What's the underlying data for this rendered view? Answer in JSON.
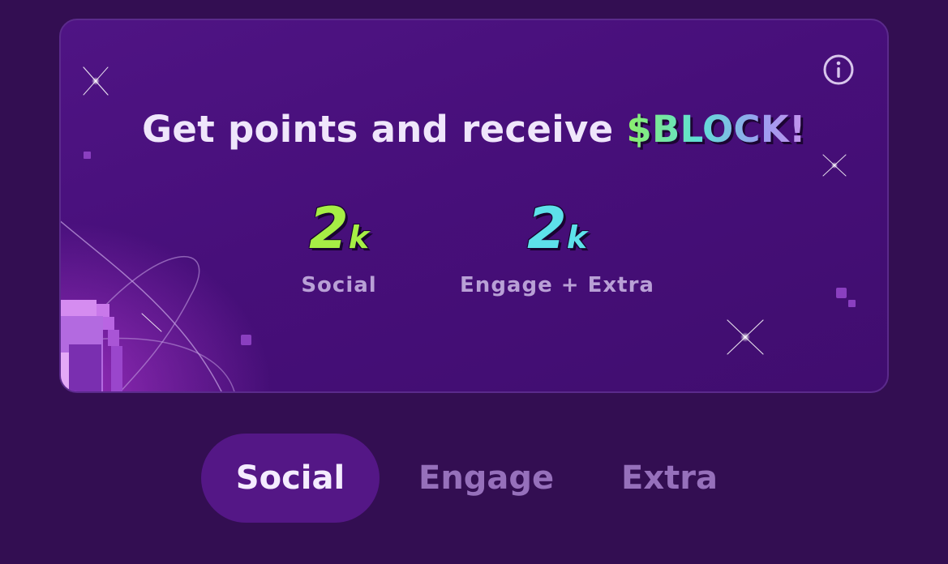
{
  "banner": {
    "headline_prefix": "Get points and receive ",
    "token": "$BLOCK!",
    "info_icon": "info-icon",
    "stats": [
      {
        "value": "2",
        "unit": "k",
        "label": "Social",
        "color": "#a6ee45"
      },
      {
        "value": "2",
        "unit": "k",
        "label": "Engage + Extra",
        "color": "#5de1ea"
      }
    ]
  },
  "tabs": [
    {
      "label": "Social",
      "active": true
    },
    {
      "label": "Engage",
      "active": false
    },
    {
      "label": "Extra",
      "active": false
    }
  ],
  "colors": {
    "background": "#330e52",
    "card": "#470f7a",
    "active_tab": "#541786",
    "inactive_tab_text": "#9670bb",
    "accent_green": "#a6ee45",
    "accent_cyan": "#5de1ea"
  }
}
